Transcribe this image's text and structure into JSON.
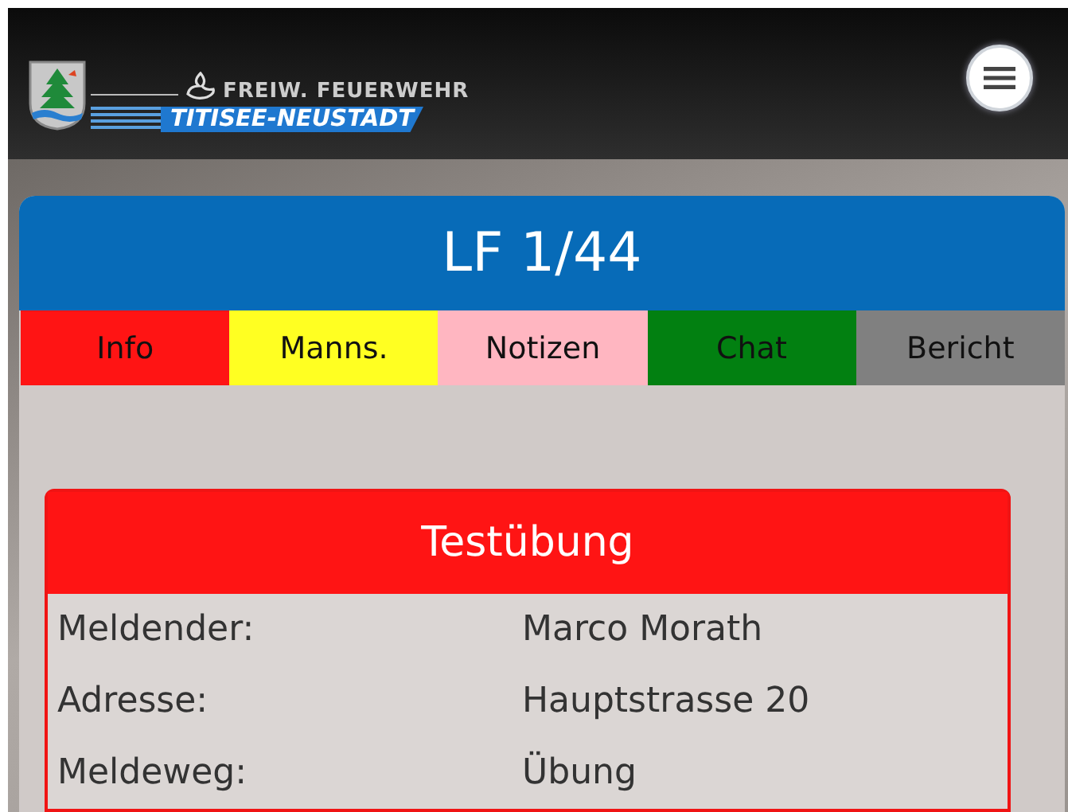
{
  "header": {
    "logo_top": "FREIW. FEUERWEHR",
    "logo_bottom": "TITISEE-NEUSTADT"
  },
  "vehicle": {
    "title": "LF 1/44"
  },
  "tabs": [
    {
      "label": "Info",
      "color": "#ff1414"
    },
    {
      "label": "Manns.",
      "color": "#ffff22"
    },
    {
      "label": "Notizen",
      "color": "#ffb6c1"
    },
    {
      "label": "Chat",
      "color": "#028011"
    },
    {
      "label": "Bericht",
      "color": "#808080"
    }
  ],
  "alarm": {
    "title": "Testübung",
    "rows": [
      {
        "label": "Meldender:",
        "value": "Marco Morath"
      },
      {
        "label": "Adresse:",
        "value": "Hauptstrasse 20"
      },
      {
        "label": "Meldeweg:",
        "value": "Übung"
      }
    ]
  }
}
